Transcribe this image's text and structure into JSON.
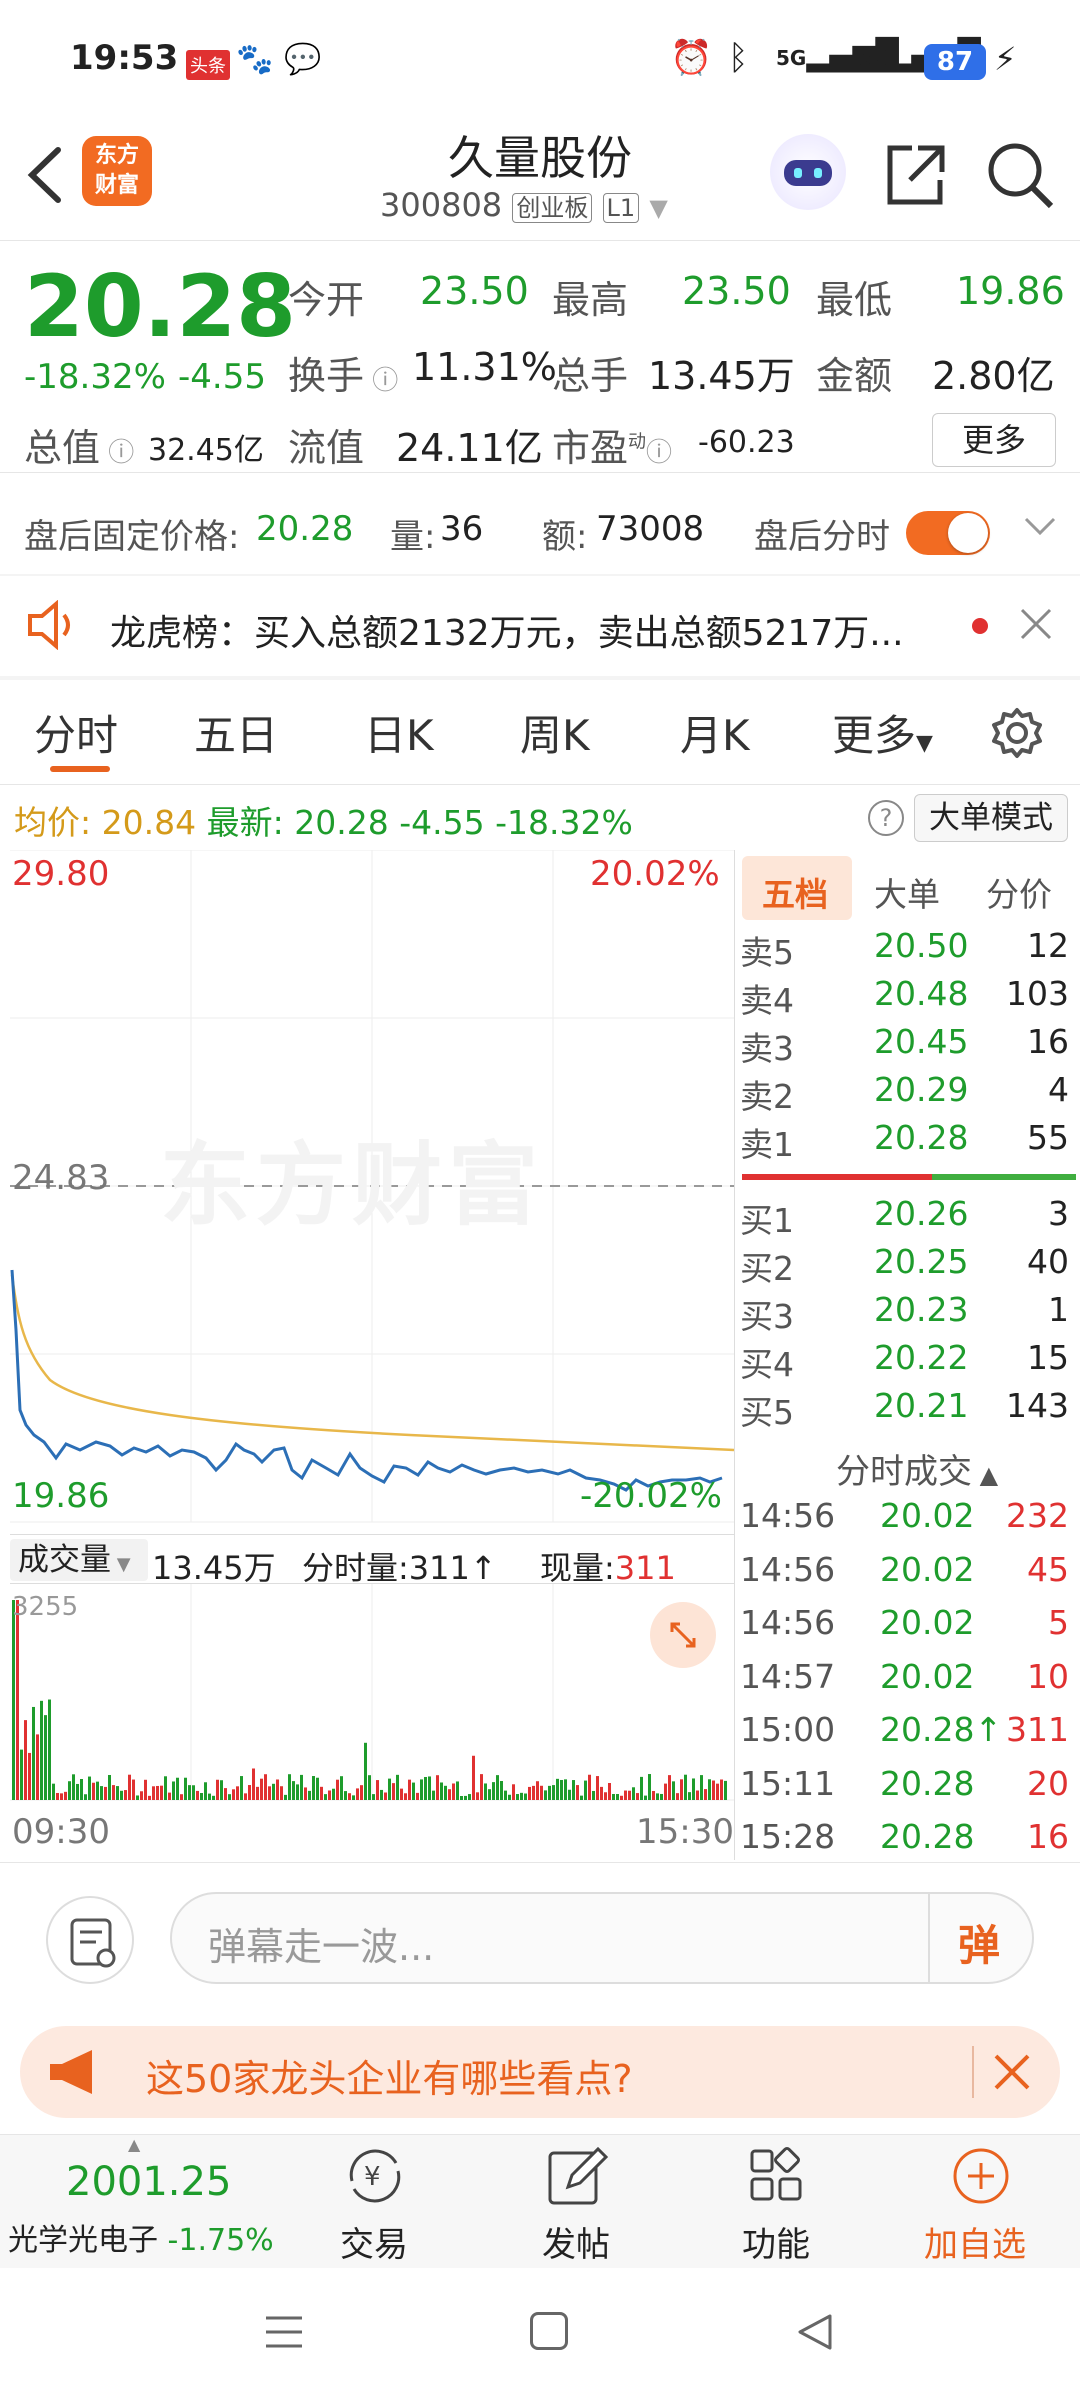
{
  "status": {
    "time": "19:53",
    "app1": "头条",
    "net1": "5G",
    "net2": "5G",
    "battery": "87"
  },
  "header": {
    "logo_top": "东方",
    "logo_bottom": "财富",
    "title": "久量股份",
    "code": "300808",
    "board": "创业板",
    "level": "L1"
  },
  "quote": {
    "price": "20.28",
    "change_pct": "-18.32%",
    "change": "-4.55",
    "open_label": "今开",
    "open": "23.50",
    "high_label": "最高",
    "high": "23.50",
    "low_label": "最低",
    "low": "19.86",
    "turnover_label": "换手",
    "turnover": "11.31%",
    "volume_label": "总手",
    "volume": "13.45万",
    "amount_label": "金额",
    "amount": "2.80亿",
    "mcap_label": "总值",
    "mcap": "32.45亿",
    "float_label": "流值",
    "float": "24.11亿",
    "pe_label": "市盈",
    "pe_sup": "动",
    "pe": "-60.23",
    "more": "更多"
  },
  "after_hours": {
    "price_label": "盘后固定价格:",
    "price": "20.28",
    "vol_label": "量:",
    "vol": "36",
    "amt_label": "额:",
    "amt": "73008",
    "toggle_label": "盘后分时"
  },
  "notice": {
    "text": "龙虎榜：买入总额2132万元，卖出总额5217万..."
  },
  "tabs": {
    "t1": "分时",
    "t2": "五日",
    "t3": "日K",
    "t4": "周K",
    "t5": "月K",
    "t6": "更多"
  },
  "info_line": {
    "avg_label": "均价:",
    "avg": "20.84",
    "last_label": "最新:",
    "last": "20.28",
    "chg": "-4.55",
    "pct": "-18.32%",
    "bigmode": "大单模式"
  },
  "chart": {
    "y_top": "29.80",
    "pct_top": "20.02%",
    "y_mid": "24.83",
    "y_bottom": "19.86",
    "pct_bottom": "-20.02%",
    "watermark": "东方财富",
    "time_start": "09:30",
    "time_end": "15:30"
  },
  "volume_bar": {
    "label": "成交量",
    "total": "13.45万",
    "period_label": "分时量:",
    "period": "311",
    "now_label": "现量:",
    "now": "311",
    "max": "3255"
  },
  "orderbook": {
    "tabs": [
      "五档",
      "大单",
      "分价"
    ],
    "asks": [
      {
        "l": "卖5",
        "p": "20.50",
        "v": "12"
      },
      {
        "l": "卖4",
        "p": "20.48",
        "v": "103"
      },
      {
        "l": "卖3",
        "p": "20.45",
        "v": "16"
      },
      {
        "l": "卖2",
        "p": "20.29",
        "v": "4"
      },
      {
        "l": "卖1",
        "p": "20.28",
        "v": "55"
      }
    ],
    "bids": [
      {
        "l": "买1",
        "p": "20.26",
        "v": "3"
      },
      {
        "l": "买2",
        "p": "20.25",
        "v": "40"
      },
      {
        "l": "买3",
        "p": "20.23",
        "v": "1"
      },
      {
        "l": "买4",
        "p": "20.22",
        "v": "15"
      },
      {
        "l": "买5",
        "p": "20.21",
        "v": "143"
      }
    ]
  },
  "ticks": {
    "title": "分时成交",
    "rows": [
      {
        "t": "14:56",
        "p": "20.02",
        "v": "232"
      },
      {
        "t": "14:56",
        "p": "20.02",
        "v": "45"
      },
      {
        "t": "14:56",
        "p": "20.02",
        "v": "5"
      },
      {
        "t": "14:57",
        "p": "20.02",
        "v": "10"
      },
      {
        "t": "15:00",
        "p": "20.28",
        "v": "311"
      },
      {
        "t": "15:11",
        "p": "20.28",
        "v": "20"
      },
      {
        "t": "15:28",
        "p": "20.28",
        "v": "16"
      }
    ]
  },
  "comment": {
    "placeholder": "弹幕走一波...",
    "danmu": "弹"
  },
  "banner": {
    "text": "这50家龙头企业有哪些看点?"
  },
  "bottom": {
    "index_value": "2001.25",
    "index_name": "光学光电子",
    "index_pct": "-1.75%",
    "trade": "交易",
    "post": "发帖",
    "func": "功能",
    "add": "加自选"
  }
}
